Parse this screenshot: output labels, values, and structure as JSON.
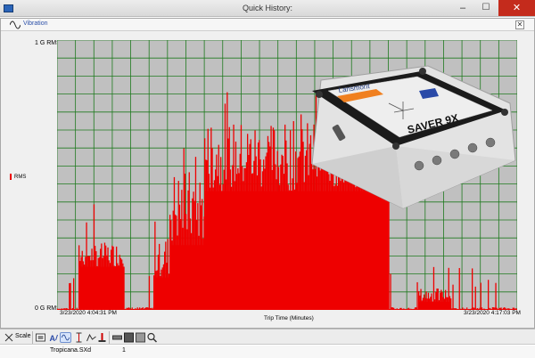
{
  "window": {
    "title": "Quick History:",
    "minimize_glyph": "–",
    "maximize_glyph": "☐",
    "close_glyph": "✕"
  },
  "panel": {
    "title": "Vibration",
    "close_glyph": "✕"
  },
  "chart": {
    "y_top_label": "1 G RMS",
    "y_bottom_label": "0 G RMS",
    "legend_label": "RMS",
    "x_start_label": "3/23/2020 4:04:31 PM",
    "x_end_label": "3/23/2020 4:17:03 PM",
    "x_axis_label": "Trip Time (Minutes)",
    "colors": {
      "plot_bg": "#c0c0c0",
      "grid": "#1f7a1f",
      "series": "#ee0000"
    }
  },
  "chart_data": {
    "type": "bar",
    "xlabel": "Trip Time (Minutes)",
    "ylabel": "",
    "ylim": [
      0,
      1
    ],
    "grid": true,
    "series": [
      {
        "name": "RMS",
        "segments": [
          {
            "start_frac": 0.0,
            "end_frac": 0.048,
            "min": 0.0,
            "max": 0.01
          },
          {
            "start_frac": 0.048,
            "end_frac": 0.145,
            "min": 0.16,
            "max": 0.25
          },
          {
            "start_frac": 0.145,
            "end_frac": 0.21,
            "min": 0.0,
            "max": 0.01
          },
          {
            "start_frac": 0.21,
            "end_frac": 0.245,
            "min": 0.12,
            "max": 0.28
          },
          {
            "start_frac": 0.245,
            "end_frac": 0.32,
            "min": 0.24,
            "max": 0.52
          },
          {
            "start_frac": 0.32,
            "end_frac": 0.72,
            "min": 0.44,
            "max": 0.7
          },
          {
            "start_frac": 0.72,
            "end_frac": 0.785,
            "min": 0.0,
            "max": 0.01
          },
          {
            "start_frac": 0.785,
            "end_frac": 0.855,
            "min": 0.03,
            "max": 0.08
          },
          {
            "start_frac": 0.855,
            "end_frac": 1.0,
            "min": 0.0,
            "max": 0.01
          }
        ]
      }
    ]
  },
  "toolbar": {
    "scale_label": "Scale",
    "icons": [
      "scale-icon",
      "settings-icon",
      "auto-scale-icon",
      "waveform-icon",
      "cursor-icon",
      "peak-icon",
      "marker-icon",
      "bar-icon",
      "stop-icon",
      "view-icon",
      "zoom-icon"
    ]
  },
  "status": {
    "file": "Tropicana.SXd",
    "count": "1"
  },
  "device": {
    "brand_label": "Lansmont",
    "model_label": "SAVER 9X",
    "colors": {
      "body": "#e6e6e6",
      "lid": "#1b1b1b",
      "label": "#f2f2f2",
      "accent": "#f08020"
    }
  }
}
